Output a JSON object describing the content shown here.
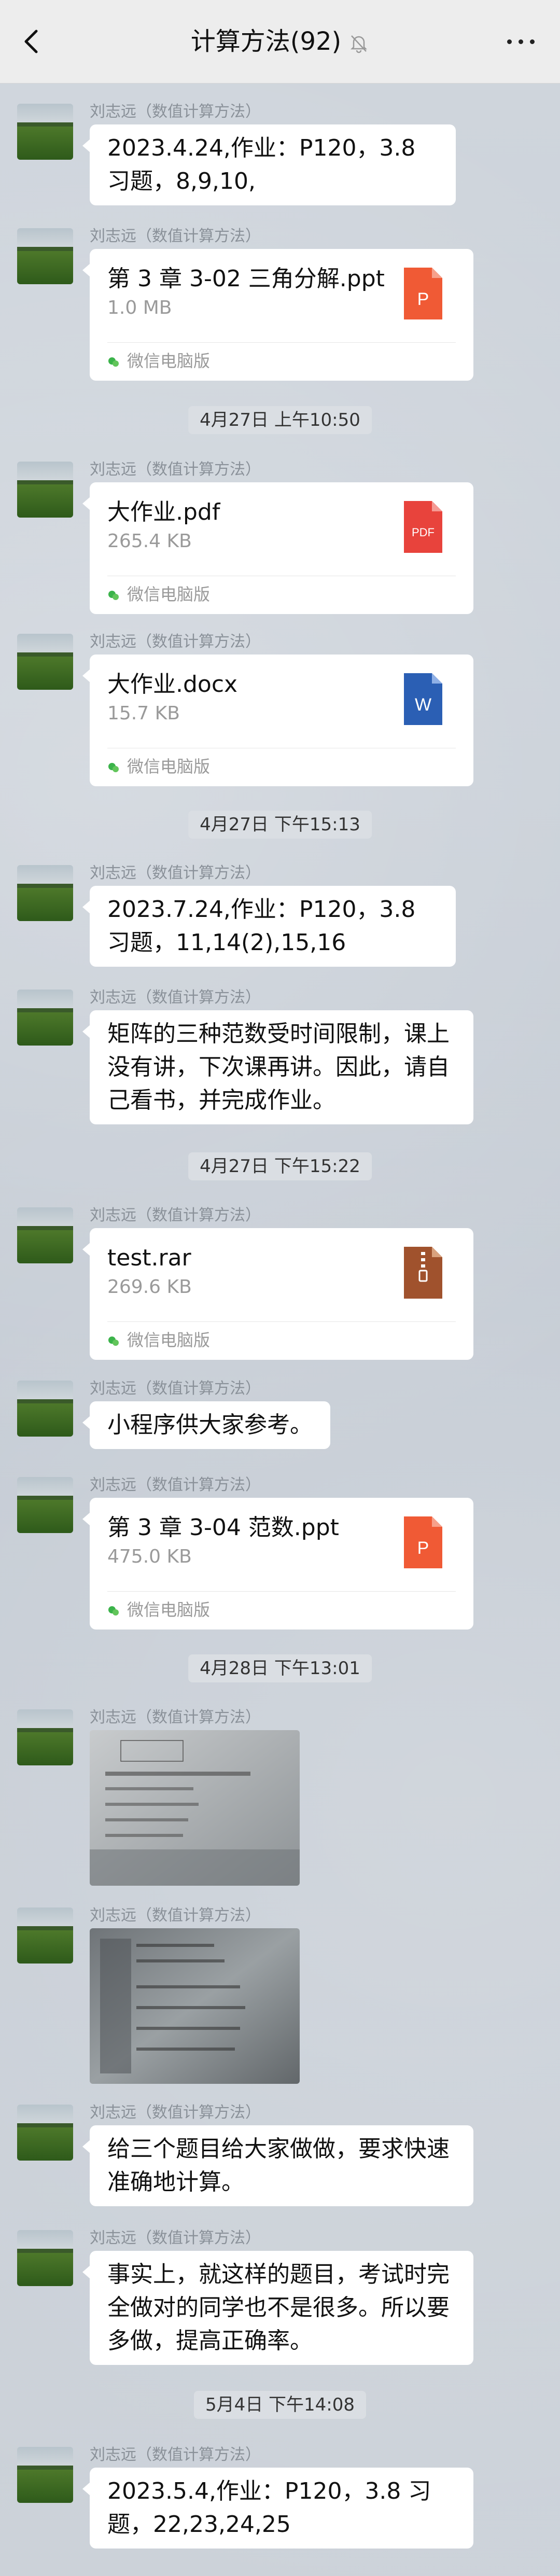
{
  "header": {
    "title": "计算方法(92)",
    "back_icon": "chevron-left-icon",
    "mute_icon": "bell-off-icon",
    "more_icon": "more-dots-icon"
  },
  "sender_name": "刘志远（数值计算方法）",
  "source_label": "微信电脑版",
  "messages": [
    {
      "type": "text",
      "text": "2023.4.24,作业：P120，3.8 习题，8,9,10,"
    },
    {
      "type": "file",
      "name": "第 3 章 3-02 三角分解.ppt",
      "size": "1.0 MB",
      "icon": "ppt-icon",
      "icon_text": "P",
      "color": "#f05a35"
    },
    {
      "type": "time",
      "text": "4月27日 上午10:50"
    },
    {
      "type": "file",
      "name": "大作业.pdf",
      "size": "265.4 KB",
      "icon": "pdf-icon",
      "icon_text": "PDF",
      "color": "#e8433c"
    },
    {
      "type": "file",
      "name": "大作业.docx",
      "size": "15.7 KB",
      "icon": "word-icon",
      "icon_text": "W",
      "color": "#2b5fb4"
    },
    {
      "type": "time",
      "text": "4月27日 下午15:13"
    },
    {
      "type": "text",
      "text": "2023.7.24,作业：P120，3.8 习题，11,14(2),15,16"
    },
    {
      "type": "text",
      "text": "矩阵的三种范数受时间限制，课上没有讲，下次课再讲。因此，请自己看书，并完成作业。"
    },
    {
      "type": "time",
      "text": "4月27日 下午15:22"
    },
    {
      "type": "file",
      "name": "test.rar",
      "size": "269.6 KB",
      "icon": "zip-icon",
      "icon_text": "",
      "color": "#a0522d"
    },
    {
      "type": "text",
      "text": "小程序供大家参考。"
    },
    {
      "type": "file",
      "name": "第 3 章 3-04 范数.ppt",
      "size": "475.0 KB",
      "icon": "ppt-icon",
      "icon_text": "P",
      "color": "#f05a35"
    },
    {
      "type": "time",
      "text": "4月28日 下午13:01"
    },
    {
      "type": "image",
      "alt": "homework photo 1"
    },
    {
      "type": "image",
      "alt": "homework photo 2"
    },
    {
      "type": "text",
      "text": "给三个题目给大家做做，要求快速准确地计算。"
    },
    {
      "type": "text",
      "text": "事实上，就这样的题目，考试时完全做对的同学也不是很多。所以要多做，提高正确率。"
    },
    {
      "type": "time",
      "text": "5月4日 下午14:08"
    },
    {
      "type": "text",
      "text": "2023.5.4,作业：P120，3.8 习题，22,23,24,25"
    }
  ]
}
